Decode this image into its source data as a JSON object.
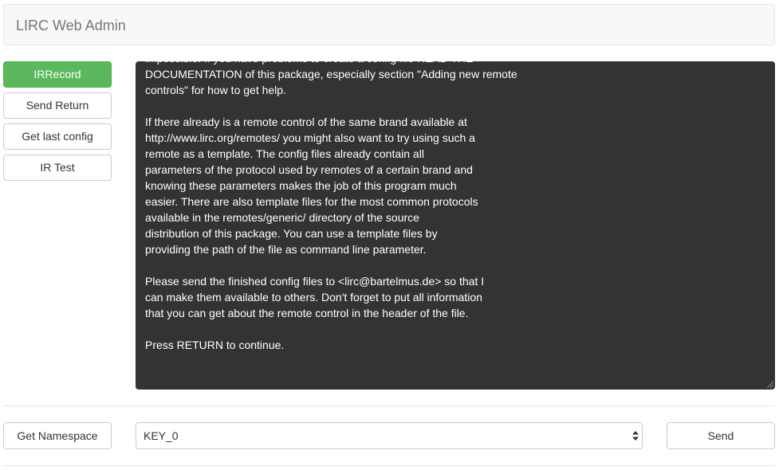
{
  "navbar": {
    "brand": "LIRC Web Admin"
  },
  "sidebar": {
    "buttons": [
      {
        "label": "IRRecord"
      },
      {
        "label": "Send Return"
      },
      {
        "label": "Get last config"
      },
      {
        "label": "IR Test"
      }
    ]
  },
  "terminal": {
    "lines": [
      "impossible. If you have problems to create a config file READ THE",
      "DOCUMENTATION of this package, especially section \"Adding new remote",
      "controls\" for how to get help.",
      "",
      "If there already is a remote control of the same brand available at",
      "http://www.lirc.org/remotes/ you might also want to try using such a",
      "remote as a template. The config files already contain all",
      "parameters of the protocol used by remotes of a certain brand and",
      "knowing these parameters makes the job of this program much",
      "easier. There are also template files for the most common protocols",
      "available in the remotes/generic/ directory of the source",
      "distribution of this package. You can use a template files by",
      "providing the path of the file as command line parameter.",
      "",
      "Please send the finished config files to <lirc@bartelmus.de> so that I",
      "can make them available to others. Don't forget to put all information",
      "that you can get about the remote control in the header of the file.",
      "",
      "Press RETURN to continue."
    ]
  },
  "bottom": {
    "namespace_button": "Get Namespace",
    "key_select": {
      "selected": "KEY_0"
    },
    "send_button": "Send"
  }
}
